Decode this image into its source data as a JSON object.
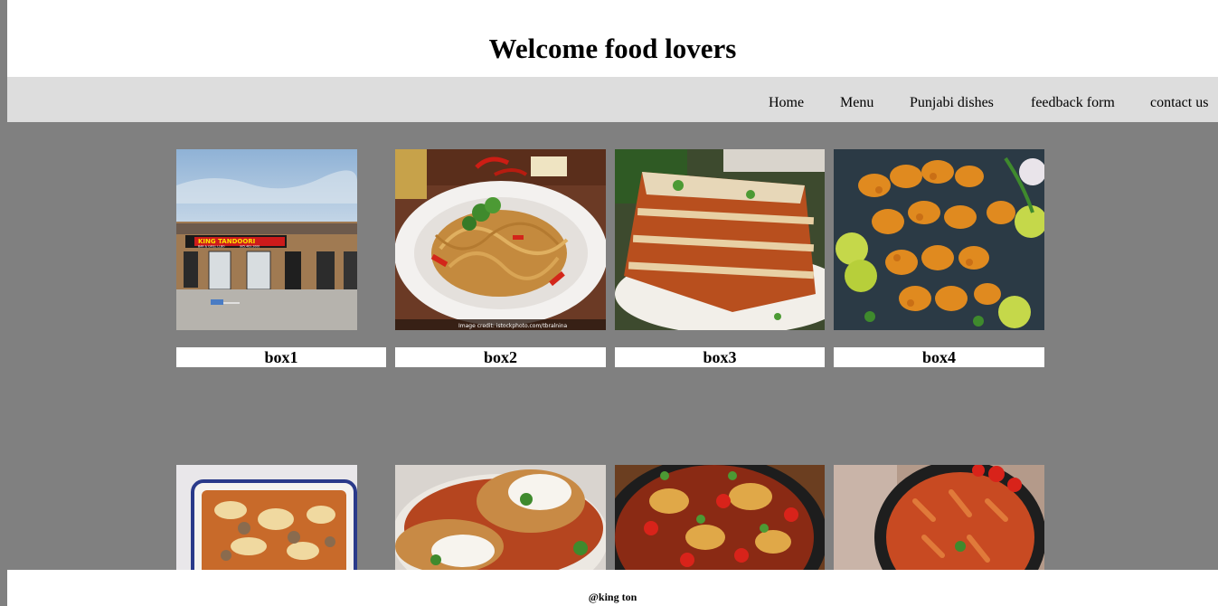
{
  "header": {
    "title": "Welcome food lovers"
  },
  "nav": {
    "items": [
      {
        "label": "Home"
      },
      {
        "label": "Menu"
      },
      {
        "label": "Punjabi dishes"
      },
      {
        "label": "feedback form"
      },
      {
        "label": "contact us"
      }
    ]
  },
  "gallery": {
    "row1": [
      {
        "label": "box1",
        "image": "restaurant-storefront",
        "sign": "KING TANDOORI",
        "sign_sub": "BAR & GRILL LLBO",
        "phone": "905.463.2000"
      },
      {
        "label": "box2",
        "image": "spaghetti-plate",
        "credit": "Image credit: istockphoto.com/tbralnina"
      },
      {
        "label": "box3",
        "image": "lasagna-slice"
      },
      {
        "label": "box4",
        "image": "chicken-tikka-skewers"
      }
    ],
    "row2": [
      {
        "image": "baked-pasta-dish"
      },
      {
        "image": "chicken-parmesan"
      },
      {
        "image": "chicken-cacciatore-pan"
      },
      {
        "image": "penne-arrabbiata-pan"
      }
    ]
  },
  "footer": {
    "text": "@king ton"
  },
  "colors": {
    "page_bg": "#808080",
    "nav_bg": "#dddddd",
    "panel_bg": "#ffffff"
  }
}
